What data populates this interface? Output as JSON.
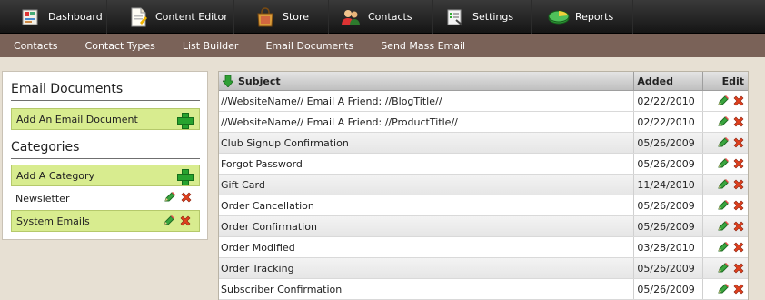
{
  "topnav": [
    {
      "label": "Dashboard",
      "icon": "dashboard-icon"
    },
    {
      "label": "Content Editor",
      "icon": "document-icon"
    },
    {
      "label": "Store",
      "icon": "store-bag-icon"
    },
    {
      "label": "Contacts",
      "icon": "contacts-icon"
    },
    {
      "label": "Settings",
      "icon": "settings-icon"
    },
    {
      "label": "Reports",
      "icon": "reports-icon"
    }
  ],
  "subnav": [
    "Contacts",
    "Contact Types",
    "List Builder",
    "Email Documents",
    "Send Mass Email"
  ],
  "left": {
    "title": "Email Documents",
    "add_document": "Add An Email Document",
    "categories_title": "Categories",
    "add_category": "Add A Category",
    "categories": [
      "Newsletter",
      "System Emails"
    ]
  },
  "table": {
    "headers": {
      "subject": "Subject",
      "added": "Added",
      "edit": "Edit"
    },
    "rows": [
      {
        "subject": "//WebsiteName// Email A Friend: //BlogTitle//",
        "added": "02/22/2010"
      },
      {
        "subject": "//WebsiteName// Email A Friend: //ProductTitle//",
        "added": "02/22/2010"
      },
      {
        "subject": "Club Signup Confirmation",
        "added": "05/26/2009"
      },
      {
        "subject": "Forgot Password",
        "added": "05/26/2009"
      },
      {
        "subject": "Gift Card",
        "added": "11/24/2010"
      },
      {
        "subject": "Order Cancellation",
        "added": "05/26/2009"
      },
      {
        "subject": "Order Confirmation",
        "added": "05/26/2009"
      },
      {
        "subject": "Order Modified",
        "added": "03/28/2010"
      },
      {
        "subject": "Order Tracking",
        "added": "05/26/2009"
      },
      {
        "subject": "Subscriber Confirmation",
        "added": "05/26/2009"
      }
    ]
  },
  "colors": {
    "topnav_bg": "#1e1e1e",
    "subnav_bg": "#7a6258",
    "green_row": "#d8ec8f",
    "page_bg": "#e7e0d3"
  }
}
